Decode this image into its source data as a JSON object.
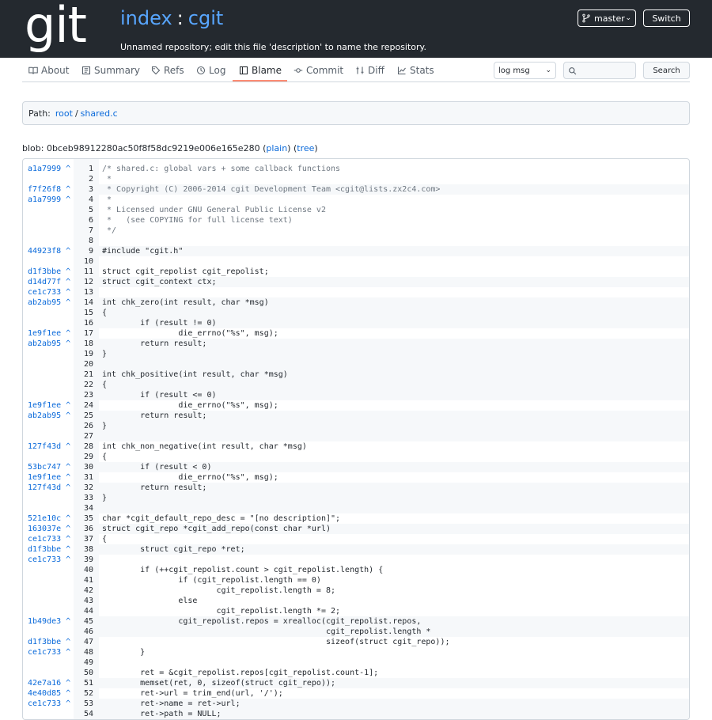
{
  "header": {
    "logo_text": "git",
    "title_index": "index",
    "title_sep": ":",
    "title_repo": "cgit",
    "description": "Unnamed repository; edit this file 'description' to name the repository.",
    "branch": "master",
    "switch_label": "Switch"
  },
  "tabs": [
    {
      "label": "About",
      "icon": "book-icon"
    },
    {
      "label": "Summary",
      "icon": "summary-icon"
    },
    {
      "label": "Refs",
      "icon": "tag-icon"
    },
    {
      "label": "Log",
      "icon": "history-icon"
    },
    {
      "label": "Blame",
      "icon": "blame-icon",
      "active": true
    },
    {
      "label": "Commit",
      "icon": "commit-icon"
    },
    {
      "label": "Diff",
      "icon": "diff-icon"
    },
    {
      "label": "Stats",
      "icon": "graph-icon"
    }
  ],
  "search": {
    "type_selected": "log msg",
    "placeholder": "",
    "button_label": "Search"
  },
  "path": {
    "label": "Path:",
    "root": "root",
    "sep": "/",
    "file": "shared.c"
  },
  "blob": {
    "prefix": "blob: 0bceb98912280ac50f8f58dc9219e006e165e280",
    "open_paren": "(",
    "plain": "plain",
    "mid": ") (",
    "tree": "tree",
    "close_paren": ")"
  },
  "blame_lines": [
    {
      "hash": "a1a7999 ^",
      "n": "1",
      "code": "/* shared.c: global vars + some callback functions",
      "comment": true
    },
    {
      "hash": "",
      "n": "2",
      "code": " *",
      "comment": true
    },
    {
      "hash": "f7f26f8 ^",
      "n": "3",
      "code": " * Copyright (C) 2006-2014 cgit Development Team <cgit@lists.zx2c4.com>",
      "comment": true,
      "hl": true
    },
    {
      "hash": "a1a7999 ^",
      "n": "4",
      "code": " *",
      "comment": true
    },
    {
      "hash": "",
      "n": "5",
      "code": " * Licensed under GNU General Public License v2",
      "comment": true
    },
    {
      "hash": "",
      "n": "6",
      "code": " *   (see COPYING for full license text)",
      "comment": true
    },
    {
      "hash": "",
      "n": "7",
      "code": " */",
      "comment": true
    },
    {
      "hash": "",
      "n": "8",
      "code": ""
    },
    {
      "hash": "44923f8 ^",
      "n": "9",
      "code": "#include \"cgit.h\"",
      "hl": true
    },
    {
      "hash": "",
      "n": "10",
      "code": ""
    },
    {
      "hash": "d1f3bbe ^",
      "n": "11",
      "code": "struct cgit_repolist cgit_repolist;"
    },
    {
      "hash": "d14d77f ^",
      "n": "12",
      "code": "struct cgit_context ctx;",
      "hl": true
    },
    {
      "hash": "ce1c733 ^",
      "n": "13",
      "code": ""
    },
    {
      "hash": "ab2ab95 ^",
      "n": "14",
      "code": "int chk_zero(int result, char *msg)",
      "hl": true
    },
    {
      "hash": "",
      "n": "15",
      "code": "{",
      "hl": true
    },
    {
      "hash": "",
      "n": "16",
      "code": "        if (result != 0)",
      "hl": true
    },
    {
      "hash": "1e9f1ee ^",
      "n": "17",
      "code": "                die_errno(\"%s\", msg);"
    },
    {
      "hash": "ab2ab95 ^",
      "n": "18",
      "code": "        return result;",
      "hl": true
    },
    {
      "hash": "",
      "n": "19",
      "code": "}",
      "hl": true
    },
    {
      "hash": "",
      "n": "20",
      "code": "",
      "hl": true
    },
    {
      "hash": "",
      "n": "21",
      "code": "int chk_positive(int result, char *msg)",
      "hl": true
    },
    {
      "hash": "",
      "n": "22",
      "code": "{",
      "hl": true
    },
    {
      "hash": "",
      "n": "23",
      "code": "        if (result <= 0)",
      "hl": true
    },
    {
      "hash": "1e9f1ee ^",
      "n": "24",
      "code": "                die_errno(\"%s\", msg);"
    },
    {
      "hash": "ab2ab95 ^",
      "n": "25",
      "code": "        return result;",
      "hl": true
    },
    {
      "hash": "",
      "n": "26",
      "code": "}",
      "hl": true
    },
    {
      "hash": "",
      "n": "27",
      "code": "",
      "hl": true
    },
    {
      "hash": "127f43d ^",
      "n": "28",
      "code": "int chk_non_negative(int result, char *msg)"
    },
    {
      "hash": "",
      "n": "29",
      "code": "{"
    },
    {
      "hash": "53bc747 ^",
      "n": "30",
      "code": "        if (result < 0)",
      "hl": true
    },
    {
      "hash": "1e9f1ee ^",
      "n": "31",
      "code": "                die_errno(\"%s\", msg);"
    },
    {
      "hash": "127f43d ^",
      "n": "32",
      "code": "        return result;",
      "hl": true
    },
    {
      "hash": "",
      "n": "33",
      "code": "}",
      "hl": true
    },
    {
      "hash": "",
      "n": "34",
      "code": "",
      "hl": true
    },
    {
      "hash": "521e10c ^",
      "n": "35",
      "code": "char *cgit_default_repo_desc = \"[no description]\";"
    },
    {
      "hash": "163037e ^",
      "n": "36",
      "code": "struct cgit_repo *cgit_add_repo(const char *url)",
      "hl": true
    },
    {
      "hash": "ce1c733 ^",
      "n": "37",
      "code": "{"
    },
    {
      "hash": "d1f3bbe ^",
      "n": "38",
      "code": "        struct cgit_repo *ret;",
      "hl": true
    },
    {
      "hash": "ce1c733 ^",
      "n": "39",
      "code": ""
    },
    {
      "hash": "",
      "n": "40",
      "code": "        if (++cgit_repolist.count > cgit_repolist.length) {"
    },
    {
      "hash": "",
      "n": "41",
      "code": "                if (cgit_repolist.length == 0)"
    },
    {
      "hash": "",
      "n": "42",
      "code": "                        cgit_repolist.length = 8;"
    },
    {
      "hash": "",
      "n": "43",
      "code": "                else"
    },
    {
      "hash": "",
      "n": "44",
      "code": "                        cgit_repolist.length *= 2;"
    },
    {
      "hash": "1b49de3 ^",
      "n": "45",
      "code": "                cgit_repolist.repos = xrealloc(cgit_repolist.repos,",
      "hl": true
    },
    {
      "hash": "",
      "n": "46",
      "code": "                                               cgit_repolist.length *",
      "hl": true
    },
    {
      "hash": "d1f3bbe ^",
      "n": "47",
      "code": "                                               sizeof(struct cgit_repo));"
    },
    {
      "hash": "ce1c733 ^",
      "n": "48",
      "code": "        }"
    },
    {
      "hash": "",
      "n": "49",
      "code": ""
    },
    {
      "hash": "",
      "n": "50",
      "code": "        ret = &cgit_repolist.repos[cgit_repolist.count-1];"
    },
    {
      "hash": "42e7a16 ^",
      "n": "51",
      "code": "        memset(ret, 0, sizeof(struct cgit_repo));",
      "hl": true
    },
    {
      "hash": "4e40d85 ^",
      "n": "52",
      "code": "        ret->url = trim_end(url, '/');"
    },
    {
      "hash": "ce1c733 ^",
      "n": "53",
      "code": "        ret->name = ret->url;",
      "hl": true
    },
    {
      "hash": "",
      "n": "54",
      "code": "        ret->path = NULL;",
      "hl": true
    }
  ]
}
